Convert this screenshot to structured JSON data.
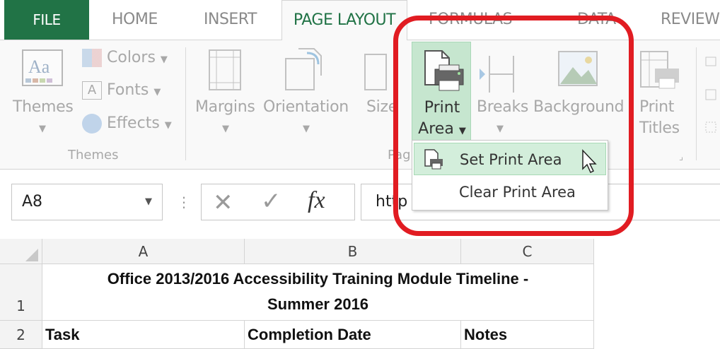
{
  "ribbon_tabs": [
    {
      "label": "FILE"
    },
    {
      "label": "HOME"
    },
    {
      "label": "INSERT"
    },
    {
      "label": "PAGE LAYOUT"
    },
    {
      "label": "FORMULAS"
    },
    {
      "label": "DATA"
    },
    {
      "label": "REVIEW"
    }
  ],
  "themes_group": {
    "themes_label": "Themes",
    "colors_label": "Colors",
    "fonts_label": "Fonts",
    "effects_label": "Effects",
    "group_label": "Themes"
  },
  "page_setup_group": {
    "margins_label": "Margins",
    "orientation_label": "Orientation",
    "size_label": "Size",
    "print_area_line1": "Print",
    "print_area_line2": "Area",
    "breaks_label": "Breaks",
    "background_label": "Background",
    "print_titles_line1": "Print",
    "print_titles_line2": "Titles",
    "group_label_partial": "Pag"
  },
  "print_area_menu": {
    "set_print_area": "Set Print Area",
    "clear_print_area": "Clear Print Area"
  },
  "formula_bar": {
    "name_box": "A8",
    "fx_label": "fx",
    "value_partial": "http"
  },
  "sheet": {
    "columns": [
      "A",
      "B",
      "C"
    ],
    "rows": [
      {
        "num": "1",
        "merged_title_line1": "Office 2013/2016 Accessibility Training Module Timeline -",
        "merged_title_line2": "Summer 2016"
      },
      {
        "num": "2",
        "cells": [
          "Task",
          "Completion Date",
          "Notes"
        ]
      }
    ]
  },
  "colors": {
    "file_tab": "#217346",
    "active_tab_text": "#217346",
    "print_area_highlight": "#c6e6cf",
    "annotation_ring": "#e11c22"
  }
}
